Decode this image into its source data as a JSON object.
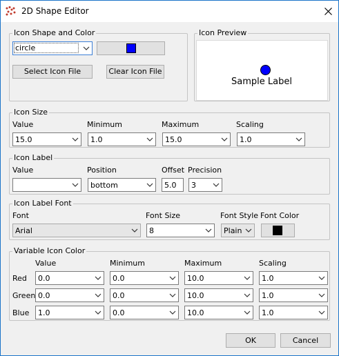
{
  "window": {
    "title": "2D Shape Editor"
  },
  "shape_color": {
    "group_title": "Icon Shape and Color",
    "shape_value": "circle",
    "color_hex": "#0000ff",
    "select_button": "Select Icon File",
    "clear_button": "Clear Icon File"
  },
  "preview": {
    "group_title": "Icon Preview",
    "label": "Sample Label",
    "dot_color": "#0000ff"
  },
  "icon_size": {
    "group_title": "Icon Size",
    "columns": [
      "Value",
      "Minimum",
      "Maximum",
      "Scaling"
    ],
    "values": [
      "15.0",
      "1.0",
      "15.0",
      "1.0"
    ]
  },
  "icon_label": {
    "group_title": "Icon Label",
    "value_label": "Value",
    "value": "",
    "position_label": "Position",
    "position_value": "bottom",
    "offset_label": "Offset",
    "offset_value": "5.0",
    "precision_label": "Precision",
    "precision_value": "3"
  },
  "label_font": {
    "group_title": "Icon Label Font",
    "font_label": "Font",
    "font_value": "Arial",
    "size_label": "Font Size",
    "size_value": "8",
    "style_label": "Font Style",
    "style_value": "Plain",
    "color_label": "Font Color",
    "color_hex": "#000000"
  },
  "variable_color": {
    "group_title": "Variable Icon Color",
    "columns": [
      "Value",
      "Minimum",
      "Maximum",
      "Scaling"
    ],
    "rows": [
      {
        "name": "Red",
        "values": [
          "0.0",
          "0.0",
          "10.0",
          "1.0"
        ]
      },
      {
        "name": "Green",
        "values": [
          "0.0",
          "0.0",
          "10.0",
          "1.0"
        ]
      },
      {
        "name": "Blue",
        "values": [
          "1.0",
          "0.0",
          "10.0",
          "1.0"
        ]
      }
    ]
  },
  "footer": {
    "ok": "OK",
    "cancel": "Cancel"
  }
}
